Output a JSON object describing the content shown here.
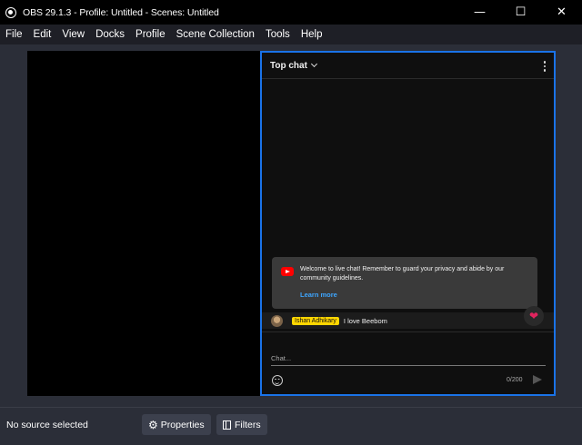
{
  "window": {
    "title": "OBS 29.1.3 - Profile: Untitled - Scenes: Untitled",
    "minimize_glyph": "—",
    "maximize_glyph": "☐",
    "close_glyph": "✕"
  },
  "menu": [
    "File",
    "Edit",
    "View",
    "Docks",
    "Profile",
    "Scene Collection",
    "Tools",
    "Help"
  ],
  "chat": {
    "header_title": "Top chat",
    "welcome_text": "Welcome to live chat! Remember to guard your privacy and abide by our community guidelines.",
    "learn_more": "Learn more",
    "message": {
      "author": "Ishan Adhikary",
      "text": "I love Beebom"
    },
    "heart_glyph": "❤",
    "input_placeholder": "Chat...",
    "char_counter": "0/200"
  },
  "status": {
    "text": "No source selected",
    "properties_label": "Properties",
    "filters_label": "Filters",
    "gear_glyph": "⚙"
  },
  "colors": {
    "accent_border": "#1a73e8",
    "author_badge": "#ffd600",
    "link": "#3ea6ff",
    "youtube_red": "#ff0000"
  }
}
